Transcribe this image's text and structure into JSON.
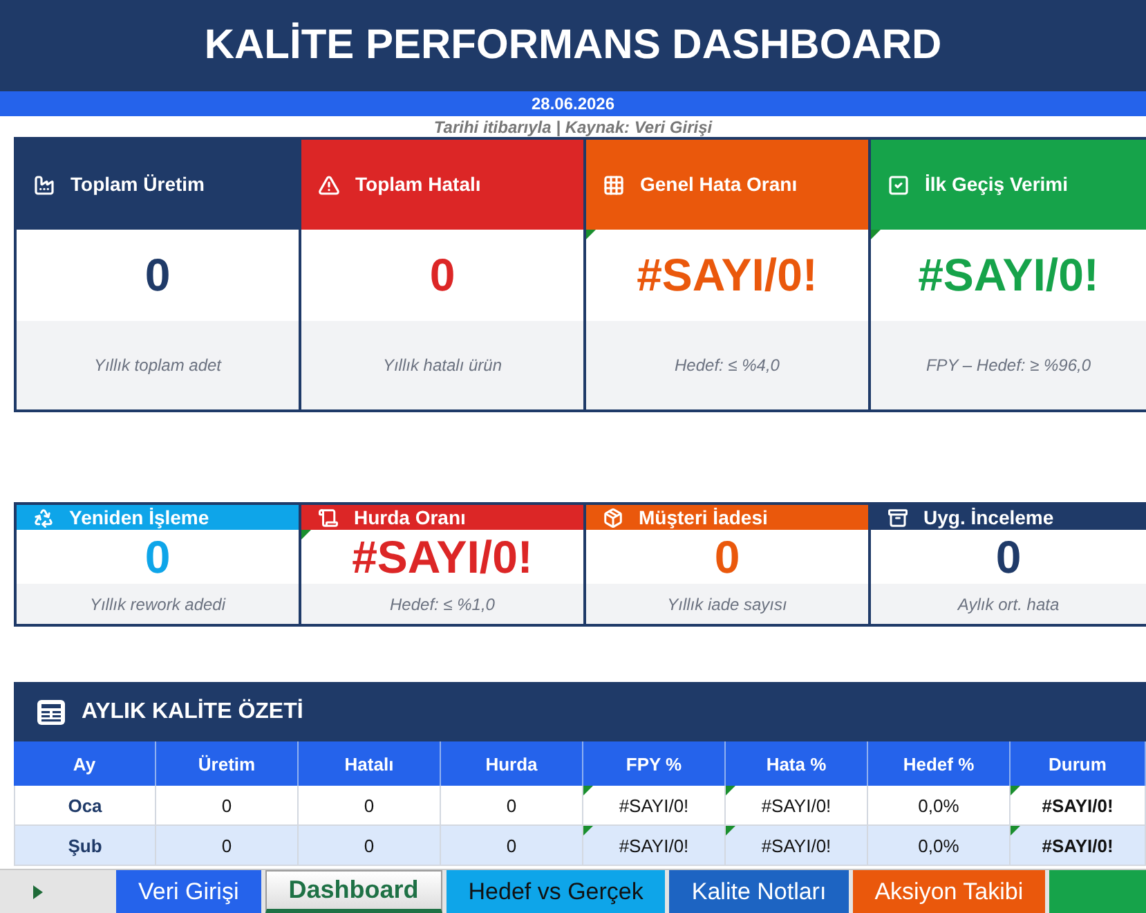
{
  "header": {
    "title": "KALİTE PERFORMANS DASHBOARD",
    "date": "28.06.2026",
    "source_note": "Tarihi itibarıyla | Kaynak: Veri Girişi"
  },
  "kpi_cards": [
    {
      "label": "Toplam Üretim",
      "value": "0",
      "caption": "Yıllık toplam adet",
      "color": "#1f3a68",
      "flagged": false
    },
    {
      "label": "Toplam Hatalı",
      "value": "0",
      "caption": "Yıllık hatalı ürün",
      "color": "#dc2626",
      "flagged": false
    },
    {
      "label": "Genel Hata Oranı",
      "value": "#SAYI/0!",
      "caption": "Hedef: ≤ %4,0",
      "color": "#ea580c",
      "flagged": true
    },
    {
      "label": "İlk Geçiş Verimi",
      "value": "#SAYI/0!",
      "caption": "FPY – Hedef: ≥ %96,0",
      "color": "#16a34a",
      "flagged": true
    }
  ],
  "secondary_cards": [
    {
      "label": "Yeniden İşleme",
      "value": "0",
      "caption": "Yıllık rework adedi",
      "color": "#0ea5e9",
      "flagged": false
    },
    {
      "label": "Hurda Oranı",
      "value": "#SAYI/0!",
      "caption": "Hedef: ≤ %1,0",
      "color": "#dc2626",
      "flagged": true
    },
    {
      "label": "Müşteri İadesi",
      "value": "0",
      "caption": "Yıllık iade sayısı",
      "color": "#ea580c",
      "flagged": false
    },
    {
      "label": "Uyg. İnceleme",
      "value": "0",
      "caption": "Aylık ort. hata",
      "color": "#1f3a68",
      "flagged": false
    }
  ],
  "monthly_summary": {
    "title": "AYLIK KALİTE ÖZETİ",
    "columns": [
      "Ay",
      "Üretim",
      "Hatalı",
      "Hurda",
      "FPY %",
      "Hata %",
      "Hedef %",
      "Durum"
    ],
    "rows": [
      {
        "cells": [
          {
            "text": "Oca",
            "flagged": false
          },
          {
            "text": "0",
            "flagged": false
          },
          {
            "text": "0",
            "flagged": false
          },
          {
            "text": "0",
            "flagged": false
          },
          {
            "text": "#SAYI/0!",
            "flagged": true
          },
          {
            "text": "#SAYI/0!",
            "flagged": true
          },
          {
            "text": "0,0%",
            "flagged": false
          },
          {
            "text": "#SAYI/0!",
            "flagged": true
          }
        ]
      },
      {
        "cells": [
          {
            "text": "Şub",
            "flagged": false
          },
          {
            "text": "0",
            "flagged": false
          },
          {
            "text": "0",
            "flagged": false
          },
          {
            "text": "0",
            "flagged": false
          },
          {
            "text": "#SAYI/0!",
            "flagged": true
          },
          {
            "text": "#SAYI/0!",
            "flagged": true
          },
          {
            "text": "0,0%",
            "flagged": false
          },
          {
            "text": "#SAYI/0!",
            "flagged": true
          }
        ]
      }
    ]
  },
  "sheet_tabs": [
    {
      "label": "Veri Girişi",
      "selected": false,
      "color": "#2563eb"
    },
    {
      "label": "Dashboard",
      "selected": true,
      "color": "#1e7145"
    },
    {
      "label": "Hedef vs Gerçek",
      "selected": false,
      "color": "#0ea5e9"
    },
    {
      "label": "Kalite Notları",
      "selected": false,
      "color": "#1d64c2"
    },
    {
      "label": "Aksiyon Takibi",
      "selected": false,
      "color": "#ea580c"
    },
    {
      "selected": false,
      "color": "#16a34a"
    }
  ]
}
